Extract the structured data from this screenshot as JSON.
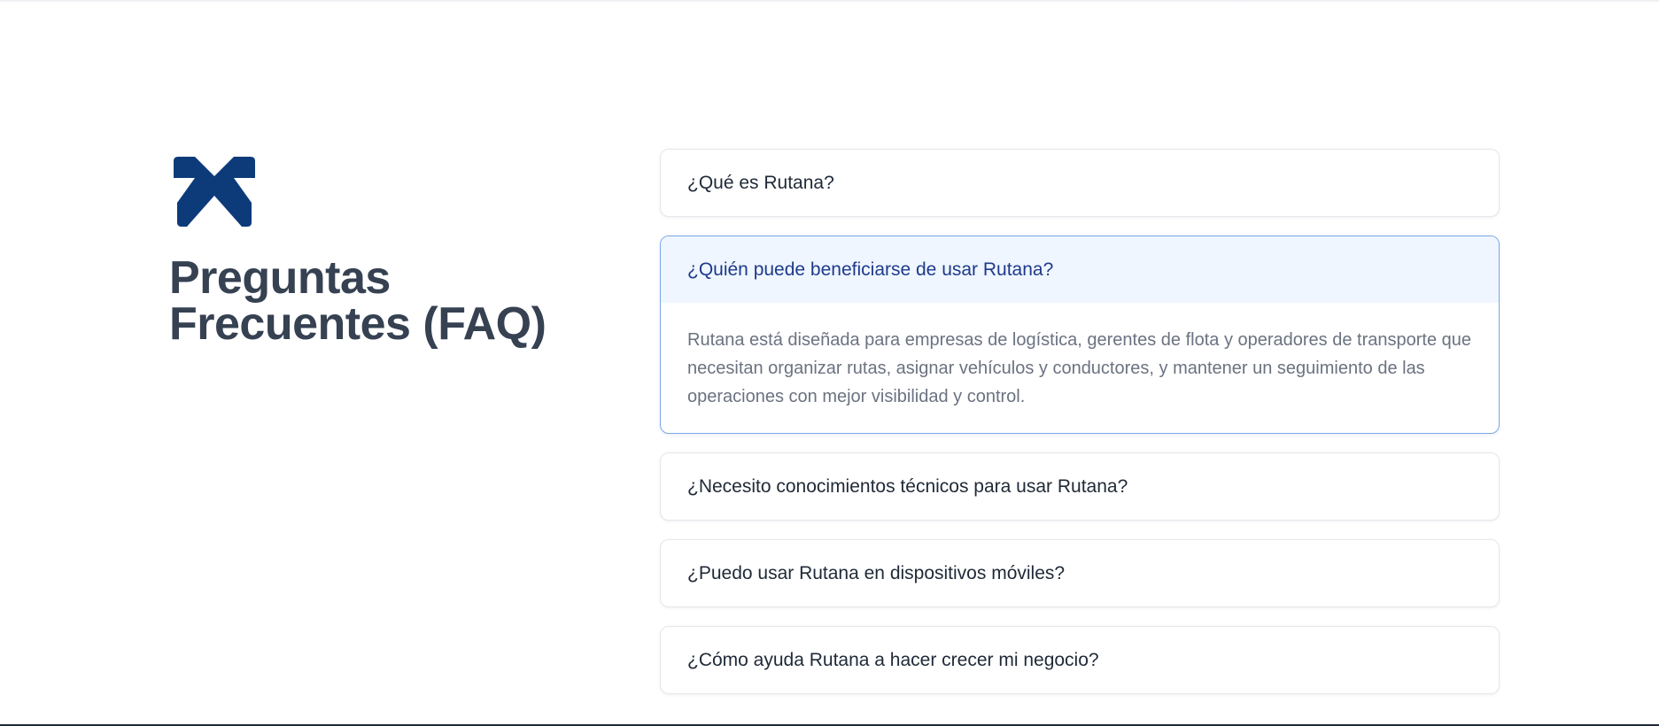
{
  "colors": {
    "logo": "#0d3b7a",
    "heading": "#364152",
    "question": "#1f2937",
    "active_question": "#1e3a8a",
    "active_background": "#eff6ff",
    "active_border": "#7ea7e6",
    "answer": "#6b7280"
  },
  "logo": {
    "icon": "chevron-up-logo-icon"
  },
  "heading": {
    "line1": "Preguntas",
    "line2": "Frecuentes (FAQ)"
  },
  "faq": {
    "items": [
      {
        "question": "¿Qué es Rutana?",
        "expanded": false
      },
      {
        "question": "¿Quién puede beneficiarse de usar Rutana?",
        "expanded": true,
        "answer": "Rutana está diseñada para empresas de logística, gerentes de flota y operadores de transporte que necesitan organizar rutas, asignar vehículos y conductores, y mantener un seguimiento de las operaciones con mejor visibilidad y control."
      },
      {
        "question": "¿Necesito conocimientos técnicos para usar Rutana?",
        "expanded": false
      },
      {
        "question": "¿Puedo usar Rutana en dispositivos móviles?",
        "expanded": false
      },
      {
        "question": "¿Cómo ayuda Rutana a hacer crecer mi negocio?",
        "expanded": false
      }
    ]
  }
}
